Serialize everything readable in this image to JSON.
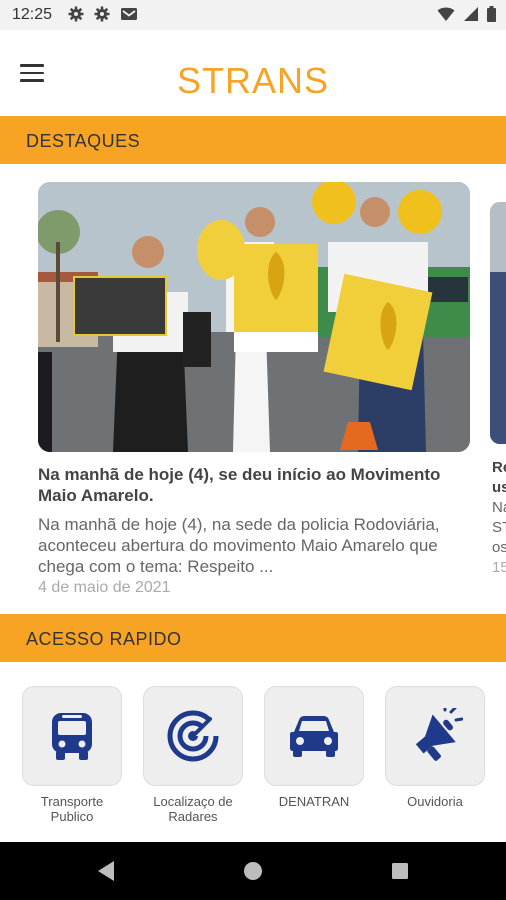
{
  "status": {
    "time": "12:25"
  },
  "header": {
    "title": "STRANS"
  },
  "highlights": {
    "section_label": "DESTAQUES",
    "card": {
      "title": "Na manhã de hoje (4), se deu início ao Movimento Maio Amarelo.",
      "excerpt": "Na manhã de hoje (4), na sede da policia Rodoviária, aconteceu abertura do movimento Maio Amarelo que chega com o tema: Respeito ...",
      "date": "4 de maio de 2021"
    },
    "peek": {
      "line1": "Re",
      "line2": "us",
      "line3": "Na",
      "line4": "ST",
      "line5": "os",
      "line6": "15"
    }
  },
  "quick_access": {
    "section_label": "ACESSO RAPIDO",
    "tiles": [
      {
        "label_line1": "Transporte",
        "label_line2": "Publico",
        "icon": "bus-icon"
      },
      {
        "label_line1": "Localizaço de",
        "label_line2": "Radares",
        "icon": "radar-icon"
      },
      {
        "label_line1": "DENATRAN",
        "label_line2": "",
        "icon": "car-icon"
      },
      {
        "label_line1": "Ouvidoria",
        "label_line2": "",
        "icon": "megaphone-icon"
      }
    ]
  },
  "colors": {
    "accent": "#f7a324",
    "icon": "#1f3a8a",
    "tile_bg": "#eeeeee"
  }
}
